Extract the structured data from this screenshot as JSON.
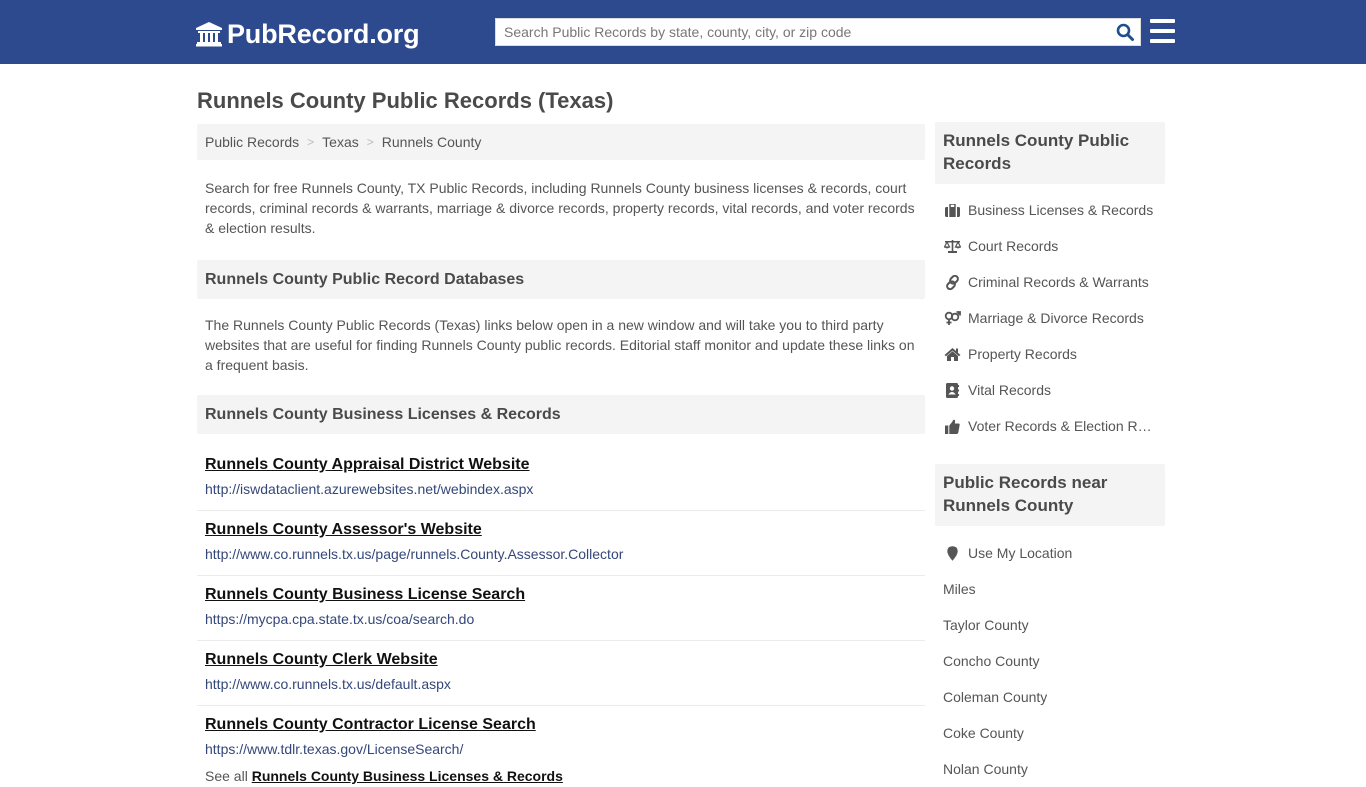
{
  "header": {
    "logo_text": "PubRecord.org",
    "search_placeholder": "Search Public Records by state, county, city, or zip code",
    "colors": {
      "brand": "#2e4a8e",
      "search_icon": "#1f4e8c"
    }
  },
  "page_title": "Runnels County Public Records (Texas)",
  "breadcrumb": [
    {
      "label": "Public Records"
    },
    {
      "label": "Texas"
    },
    {
      "label": "Runnels County"
    }
  ],
  "breadcrumb_separator": ">",
  "intro": "Search for free Runnels County, TX Public Records, including Runnels County business licenses & records, court records, criminal records & warrants, marriage & divorce records, property records, vital records, and voter records & election results.",
  "databases": {
    "heading": "Runnels County Public Record Databases",
    "description": "The Runnels County Public Records (Texas) links below open in a new window and will take you to third party websites that are useful for finding Runnels County public records. Editorial staff monitor and update these links on a frequent basis."
  },
  "business_section": {
    "heading": "Runnels County Business Licenses & Records",
    "links": [
      {
        "title": "Runnels County Appraisal District Website",
        "url": "http://iswdataclient.azurewebsites.net/webindex.aspx"
      },
      {
        "title": "Runnels County Assessor's Website",
        "url": "http://www.co.runnels.tx.us/page/runnels.County.Assessor.Collector"
      },
      {
        "title": "Runnels County Business License Search",
        "url": "https://mycpa.cpa.state.tx.us/coa/search.do"
      },
      {
        "title": "Runnels County Clerk Website",
        "url": "http://www.co.runnels.tx.us/default.aspx"
      },
      {
        "title": "Runnels County Contractor License Search",
        "url": "https://www.tdlr.texas.gov/LicenseSearch/"
      }
    ],
    "see_all_prefix": "See all",
    "see_all_link": "Runnels County Business Licenses & Records"
  },
  "sidebar": {
    "records": {
      "heading": "Runnels County Public Records",
      "items": [
        {
          "icon": "briefcase-icon",
          "label": "Business Licenses & Records"
        },
        {
          "icon": "balance-scale-icon",
          "label": "Court Records"
        },
        {
          "icon": "link-icon",
          "label": "Criminal Records & Warrants"
        },
        {
          "icon": "venus-mars-icon",
          "label": "Marriage & Divorce Records"
        },
        {
          "icon": "home-icon",
          "label": "Property Records"
        },
        {
          "icon": "address-book-icon",
          "label": "Vital Records"
        },
        {
          "icon": "thumbs-up-icon",
          "label": "Voter Records & Election Results"
        }
      ]
    },
    "nearby": {
      "heading": "Public Records near Runnels County",
      "location_label": "Use My Location",
      "miles_label": "Miles",
      "counties": [
        "Taylor County",
        "Concho County",
        "Coleman County",
        "Coke County",
        "Nolan County"
      ]
    }
  }
}
